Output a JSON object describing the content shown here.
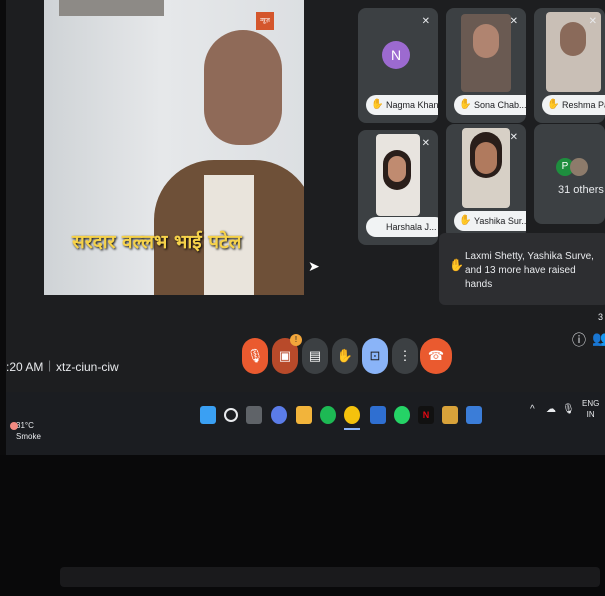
{
  "main_video": {
    "caption": "सरदार वल्लभ भाई पटेल",
    "channel_tag": "न्यूज़"
  },
  "participants": [
    {
      "name": "Nagma Khan",
      "avatar_letter": "N"
    },
    {
      "name": "Sona Chab..."
    },
    {
      "name": "Reshma Pa..."
    },
    {
      "name": "Harshala J..."
    },
    {
      "name": "Yashika Sur..."
    }
  ],
  "others": {
    "count_label": "31 others",
    "avatar_letter": "P"
  },
  "raised_hands": {
    "text": "Laxmi Shetty, Yashika Surve, and 13 more have raised hands"
  },
  "meeting": {
    "time": ":20 AM",
    "separator": "|",
    "code": "xtz-ciun-ciw"
  },
  "controls": [
    {
      "name": "mic-off-button",
      "icon": "mic-off-icon",
      "glyph": "🎙"
    },
    {
      "name": "camera-off-button",
      "icon": "camera-off-icon",
      "glyph": "▣",
      "badge": "!"
    },
    {
      "name": "captions-button",
      "icon": "captions-icon",
      "glyph": "▤"
    },
    {
      "name": "raise-hand-button",
      "icon": "hand-icon",
      "glyph": "✋"
    },
    {
      "name": "present-button",
      "icon": "present-icon",
      "glyph": "⊡"
    },
    {
      "name": "more-options-button",
      "icon": "more-vert-icon",
      "glyph": "⋮"
    },
    {
      "name": "leave-call-button",
      "icon": "phone-hangup-icon",
      "glyph": "☎"
    }
  ],
  "right_controls": {
    "info_glyph": "ⓘ",
    "people_glyph": "👥",
    "people_count": "3"
  },
  "taskbar": {
    "weather_temp": "31°C",
    "weather_desc": "Smoke",
    "language_line1": "ENG",
    "language_line2": "IN",
    "tray_chevron": "^",
    "colors": {
      "windows": "#3aa0f3",
      "spotify": "#1db954",
      "chrome": "#f4c20d",
      "whatsapp": "#25d366",
      "netflix": "#e50914",
      "leave": "#ea5a2f"
    }
  }
}
